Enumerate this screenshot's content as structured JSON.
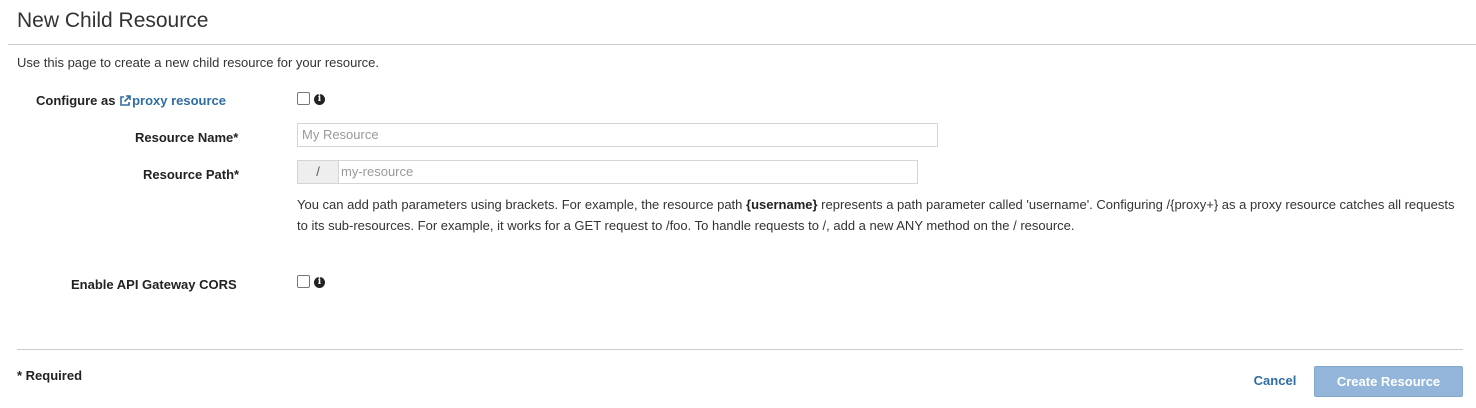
{
  "page": {
    "title": "New Child Resource",
    "intro": "Use this page to create a new child resource for your resource."
  },
  "form": {
    "proxy": {
      "label_prefix": "Configure as ",
      "link_text": "proxy resource",
      "link_icon": "external-link-icon",
      "checked": false,
      "info_icon": "info-icon"
    },
    "resource_name": {
      "label": "Resource Name*",
      "placeholder": "My Resource",
      "value": ""
    },
    "resource_path": {
      "label": "Resource Path*",
      "prefix": "/",
      "placeholder": "my-resource",
      "value": ""
    },
    "help": {
      "part1": "You can add path parameters using brackets. For example, the resource path ",
      "bold": "{username}",
      "part2": " represents a path parameter called 'username'. Configuring /{proxy+} as a proxy resource catches all requests to its sub-resources. For example, it works for a GET request to /foo. To handle requests to /, add a new ANY method on the / resource."
    },
    "cors": {
      "label": "Enable API Gateway CORS",
      "checked": false,
      "info_icon": "info-icon"
    }
  },
  "footer": {
    "required_note": "* Required",
    "cancel_label": "Cancel",
    "create_label": "Create Resource"
  },
  "colors": {
    "link": "#2e6da4",
    "primary_button_disabled": "#92b5d9",
    "rule": "#cccccc"
  }
}
